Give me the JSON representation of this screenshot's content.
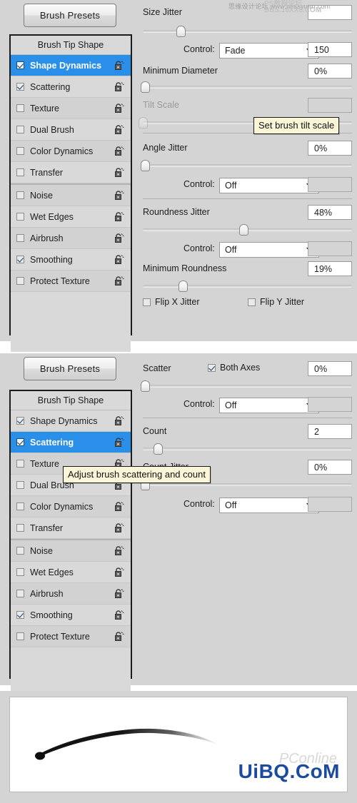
{
  "app": {
    "name": "Photoshop Brush Panel",
    "presets_button": "Brush Presets",
    "list_header": "Brush Tip Shape"
  },
  "colors": {
    "panel_bg": "#d4d4d4",
    "list_bg": "#d9d9d9",
    "selection": "#2a8fe8",
    "tooltip_bg": "#fbf6d8",
    "tooltip_border": "#1c1c1c",
    "watermark_blue": "#1b4b9e"
  },
  "panel1": {
    "presets_button": "Brush Presets",
    "list_header": "Brush Tip Shape",
    "items": [
      {
        "label": "Shape Dynamics",
        "checked": true,
        "selected": true,
        "lock": "padlock-open-icon"
      },
      {
        "label": "Scattering",
        "checked": true,
        "selected": false,
        "lock": "padlock-open-icon"
      },
      {
        "label": "Texture",
        "checked": false,
        "selected": false,
        "lock": "padlock-open-icon"
      },
      {
        "label": "Dual Brush",
        "checked": false,
        "selected": false,
        "lock": "padlock-open-icon"
      },
      {
        "label": "Color Dynamics",
        "checked": false,
        "selected": false,
        "lock": "padlock-open-icon"
      },
      {
        "label": "Transfer",
        "checked": false,
        "selected": false,
        "lock": "padlock-open-icon"
      },
      {
        "label": "Noise",
        "checked": false,
        "selected": false,
        "lock": "padlock-open-icon",
        "group_start": true
      },
      {
        "label": "Wet Edges",
        "checked": false,
        "selected": false,
        "lock": "padlock-open-icon"
      },
      {
        "label": "Airbrush",
        "checked": false,
        "selected": false,
        "lock": "padlock-open-icon"
      },
      {
        "label": "Smoothing",
        "checked": true,
        "selected": false,
        "lock": "padlock-open-icon"
      },
      {
        "label": "Protect Texture",
        "checked": false,
        "selected": false,
        "lock": "padlock-open-icon"
      }
    ],
    "controls": {
      "size_jitter": {
        "label": "Size Jitter",
        "value": "",
        "slider_pct": 18
      },
      "size_control": {
        "label": "Control:",
        "option": "Fade",
        "extra_value": "150"
      },
      "minimum_diameter": {
        "label": "Minimum Diameter",
        "value": "0%",
        "slider_pct": 1
      },
      "tilt_scale": {
        "label": "Tilt Scale",
        "value": "",
        "slider_pct": 0,
        "disabled": true
      },
      "angle_jitter": {
        "label": "Angle Jitter",
        "value": "0%",
        "slider_pct": 1
      },
      "angle_control": {
        "label": "Control:",
        "option": "Off",
        "extra_value": ""
      },
      "roundness_jitter": {
        "label": "Roundness Jitter",
        "value": "48%",
        "slider_pct": 48
      },
      "roundness_control": {
        "label": "Control:",
        "option": "Off",
        "extra_value": ""
      },
      "minimum_roundness": {
        "label": "Minimum Roundness",
        "value": "19%",
        "slider_pct": 19
      },
      "flip_x": {
        "label": "Flip X Jitter",
        "checked": false
      },
      "flip_y": {
        "label": "Flip Y Jitter",
        "checked": false
      }
    },
    "tooltip": "Set brush tilt scale"
  },
  "panel2": {
    "presets_button": "Brush Presets",
    "list_header": "Brush Tip Shape",
    "items": [
      {
        "label": "Shape Dynamics",
        "checked": true,
        "selected": false,
        "lock": "padlock-open-icon"
      },
      {
        "label": "Scattering",
        "checked": true,
        "selected": true,
        "lock": "padlock-open-icon"
      },
      {
        "label": "Texture",
        "checked": false,
        "selected": false,
        "lock": "padlock-open-icon"
      },
      {
        "label": "Dual Brush",
        "checked": false,
        "selected": false,
        "lock": "padlock-open-icon"
      },
      {
        "label": "Color Dynamics",
        "checked": false,
        "selected": false,
        "lock": "padlock-open-icon"
      },
      {
        "label": "Transfer",
        "checked": false,
        "selected": false,
        "lock": "padlock-open-icon"
      },
      {
        "label": "Noise",
        "checked": false,
        "selected": false,
        "lock": "padlock-open-icon",
        "group_start": true
      },
      {
        "label": "Wet Edges",
        "checked": false,
        "selected": false,
        "lock": "padlock-open-icon"
      },
      {
        "label": "Airbrush",
        "checked": false,
        "selected": false,
        "lock": "padlock-open-icon"
      },
      {
        "label": "Smoothing",
        "checked": true,
        "selected": false,
        "lock": "padlock-open-icon"
      },
      {
        "label": "Protect Texture",
        "checked": false,
        "selected": false,
        "lock": "padlock-open-icon"
      }
    ],
    "controls": {
      "scatter": {
        "label": "Scatter",
        "value": "0%",
        "slider_pct": 1
      },
      "both_axes": {
        "label": "Both Axes",
        "checked": true
      },
      "scatter_control": {
        "label": "Control:",
        "option": "Off",
        "extra_value": ""
      },
      "count": {
        "label": "Count",
        "value": "2",
        "slider_pct": 7
      },
      "count_jitter": {
        "label": "Count Jitter",
        "value": "0%",
        "slider_pct": 1
      },
      "count_control": {
        "label": "Control:",
        "option": "Off",
        "extra_value": ""
      }
    },
    "tooltip": "Adjust brush scattering and count"
  },
  "panel3": {
    "preview_label": "brush-stroke-preview"
  },
  "watermarks": {
    "top_cn": "思缘设计论坛 www.missyuan.com",
    "top_overlay_line1": "PS教程论坛",
    "top_overlay_line2": "BBS.16XX8.COM",
    "bottom_blue": "UiBQ.CoM",
    "bottom_faint": "PConline"
  }
}
